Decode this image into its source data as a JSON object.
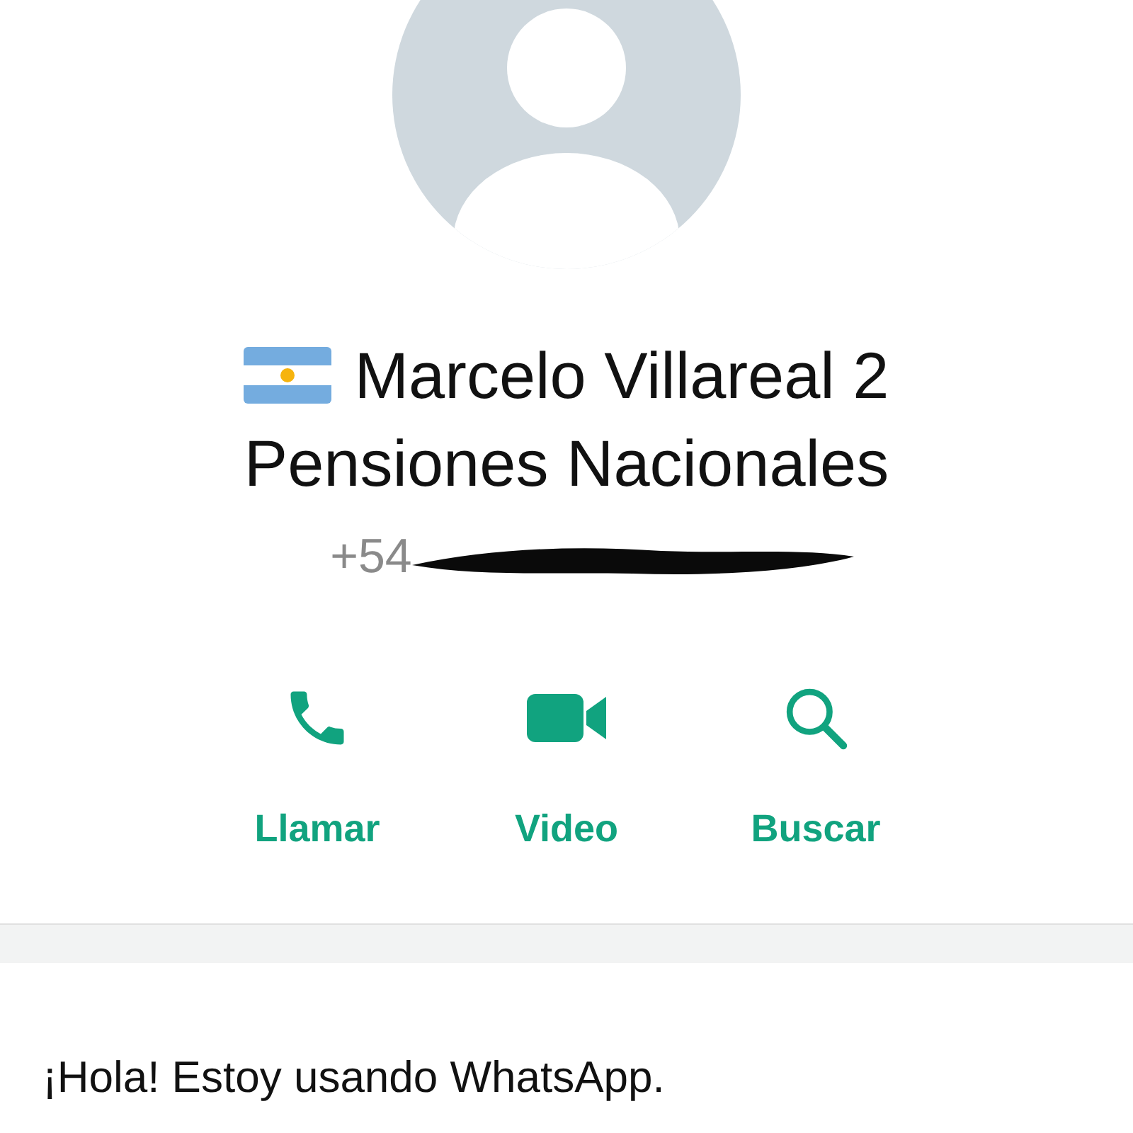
{
  "contact": {
    "name_lines": [
      "Marcelo Villareal 2",
      "Pensiones Nacionales"
    ],
    "phone": "+54"
  },
  "actions": [
    {
      "kind": "call",
      "label": "Llamar"
    },
    {
      "kind": "video",
      "label": "Video"
    },
    {
      "kind": "search",
      "label": "Buscar"
    }
  ],
  "about": {
    "text": "¡Hola! Estoy usando WhatsApp."
  }
}
